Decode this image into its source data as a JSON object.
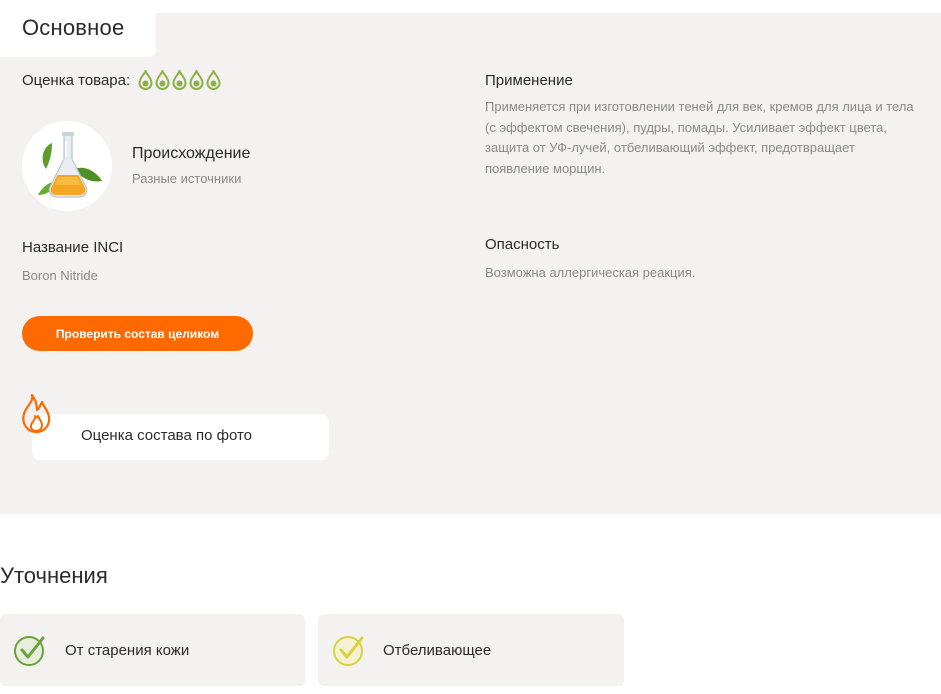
{
  "main": {
    "tab_label": "Основное",
    "rating": {
      "label": "Оценка товара:",
      "value": 5,
      "max": 5,
      "icon": "drop-icon",
      "color": "#8db04a"
    },
    "origin": {
      "title": "Происхождение",
      "value": "Разные источники",
      "image": "flask-with-leaves"
    },
    "inci": {
      "title": "Название INCI",
      "value": "Boron Nitride"
    },
    "check_button": "Проверить состав целиком",
    "photo": {
      "label": "Оценка состава по фото",
      "icon": "flame-icon"
    },
    "usage": {
      "title": "Применение",
      "text": "Применяется при изготовлении теней для век, кремов для лица и тела (с эффектом свечения), пудры, помады. Усиливает эффект цвета, защита от УФ-лучей, отбеливающий эффект, предотвращает появление морщин."
    },
    "danger": {
      "title": "Опасность",
      "text": "Возможна аллергическая реакция."
    }
  },
  "clarifications": {
    "title": "Уточнения",
    "tags": [
      {
        "label": "От старения кожи",
        "icon": "check-circle-icon",
        "color": "#6aa33b"
      },
      {
        "label": "Отбеливающее",
        "icon": "check-circle-icon",
        "color": "#d9d23a"
      }
    ]
  },
  "colors": {
    "accent": "#ff6a00",
    "panel": "#f3f2f0",
    "muted_text": "#8a8a8a"
  }
}
